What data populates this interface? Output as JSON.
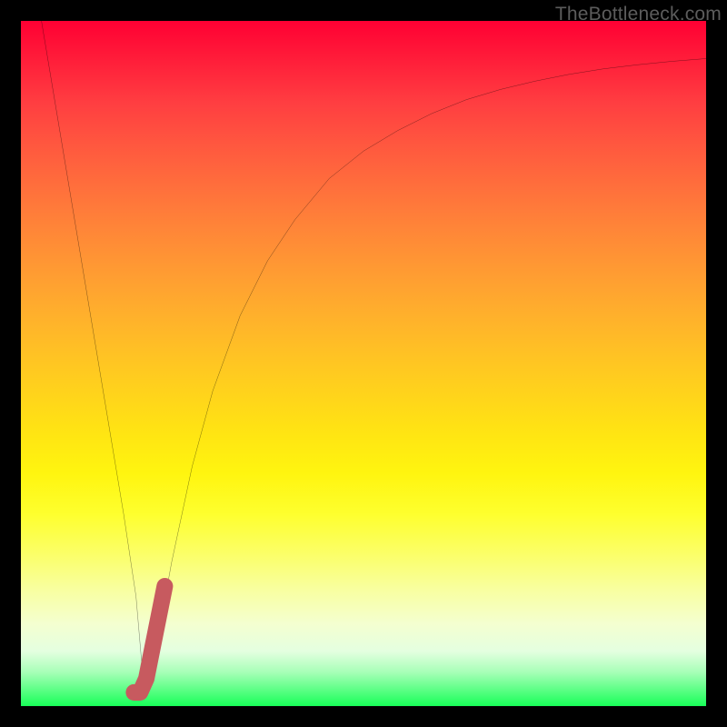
{
  "watermark": "TheBottleneck.com",
  "colors": {
    "frame": "#000000",
    "curve": "#000000",
    "tick": "#c75a5f",
    "gradient_top": "#ff0033",
    "gradient_bottom": "#18ff58"
  },
  "chart_data": {
    "type": "line",
    "title": "",
    "xlabel": "",
    "ylabel": "",
    "xlim": [
      0,
      100
    ],
    "ylim": [
      0,
      100
    ],
    "grid": false,
    "legend": false,
    "series": [
      {
        "name": "bottleneck-curve",
        "x": [
          3,
          5,
          7,
          9,
          11,
          13,
          15,
          16.8,
          18,
          20,
          22,
          25,
          28,
          32,
          36,
          40,
          45,
          50,
          55,
          60,
          65,
          70,
          75,
          80,
          85,
          90,
          95,
          100
        ],
        "y": [
          100,
          88,
          76,
          64,
          52,
          40,
          28,
          16,
          2,
          10,
          21,
          35,
          46,
          57,
          65,
          71,
          77,
          81,
          84,
          86.5,
          88.5,
          90,
          91.2,
          92.2,
          93,
          93.6,
          94.1,
          94.5
        ]
      },
      {
        "name": "tick-mark",
        "x": [
          16.5,
          17.4,
          18.3,
          19.2,
          20.1,
          21.0
        ],
        "y": [
          2.0,
          2.0,
          4.0,
          8.5,
          13.0,
          17.5
        ]
      }
    ],
    "annotations": []
  }
}
